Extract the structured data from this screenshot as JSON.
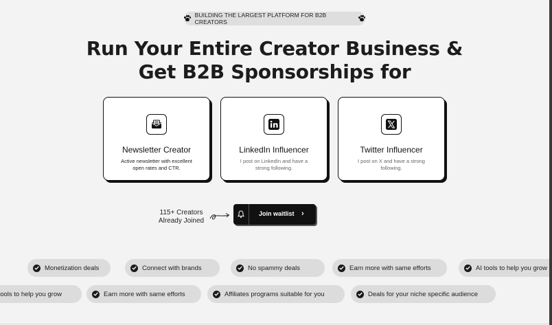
{
  "badge": {
    "text": "BUILDING THE LARGEST PLATFORM FOR B2B CREATORS",
    "icon": "paw-icon"
  },
  "hero": {
    "line1": "Run Your Entire Creator Business &",
    "line2": "Get B2B Sponsorships for"
  },
  "cards": [
    {
      "icon": "newsletter-envelope-icon",
      "title": "Newsletter Creator",
      "desc": "Active newsletter with excellent open rates and CTR."
    },
    {
      "icon": "linkedin-icon",
      "title": "LinkedIn Influencer",
      "desc": "I post on LinkedIn and have a strong following."
    },
    {
      "icon": "x-icon",
      "title": "Twitter Influencer",
      "desc": "I post on X and have a strong following."
    }
  ],
  "waitlist": {
    "joined_line1": "115+ Creators",
    "joined_line2": "Already Joined",
    "button_label": "Join waitlist",
    "button_icon": "bell-icon",
    "arrow_icon": "chevron-right-icon"
  },
  "pills_row1": [
    "Monetization deals",
    "Connect with brands",
    "No spammy deals",
    "Earn more with same efforts",
    "AI tools to help you grow"
  ],
  "pills_row2": [
    "AI tools to help you grow",
    "Earn more with same efforts",
    "Affiliates programs suitable for you",
    "Deals for your niche specific audience"
  ],
  "colors": {
    "background": "#f3f3f3",
    "pill": "#dcdcdc",
    "ink": "#111111"
  }
}
